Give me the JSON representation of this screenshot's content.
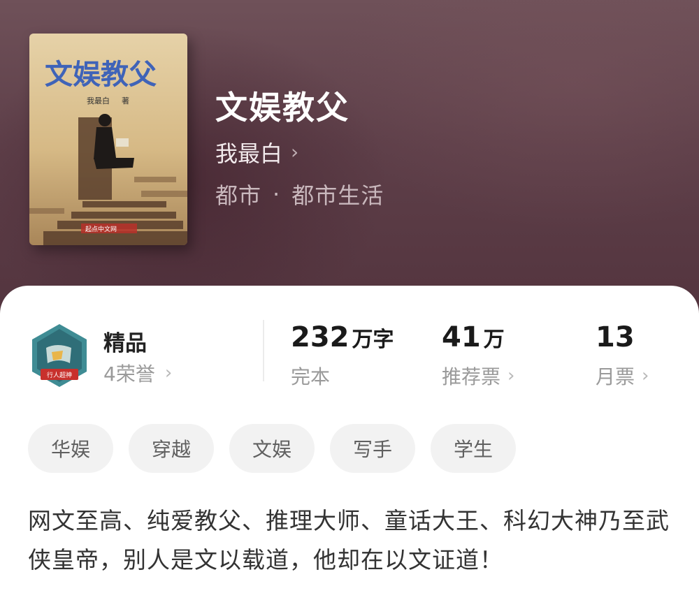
{
  "book": {
    "cover": {
      "title": "文娱教父",
      "author_line": "我最白",
      "author_suffix": "著",
      "publisher_mark": "起点中文网"
    },
    "title": "文娱教父",
    "author": "我最白",
    "category": "都市",
    "subcategory": "都市生活"
  },
  "honor": {
    "badge_text": "行人超神",
    "level": "精品",
    "count": "4荣誉"
  },
  "stats": {
    "words": {
      "value": "232",
      "unit": "万字",
      "label": "完本"
    },
    "recommend": {
      "value": "41",
      "unit": "万",
      "label": "推荐票"
    },
    "monthly": {
      "value": "13",
      "unit": "",
      "label": "月票"
    }
  },
  "tags": [
    "华娱",
    "穿越",
    "文娱",
    "写手",
    "学生"
  ],
  "description": "网文至高、纯爱教父、推理大师、童话大王、科幻大神乃至武侠皇帝，别人是文以载道，他却在以文证道！",
  "colors": {
    "hero_bg": "#5e3f49",
    "title_text": "#ffffff",
    "tag_bg": "#f2f2f2",
    "badge_teal": "#3f8c94",
    "badge_red": "#c8302c"
  },
  "icons": {
    "author_chevron": "chevron-right-icon",
    "honor_chevron": "chevron-right-icon",
    "stat_chevron": "chevron-right-icon",
    "badge": "honor-badge-icon"
  }
}
